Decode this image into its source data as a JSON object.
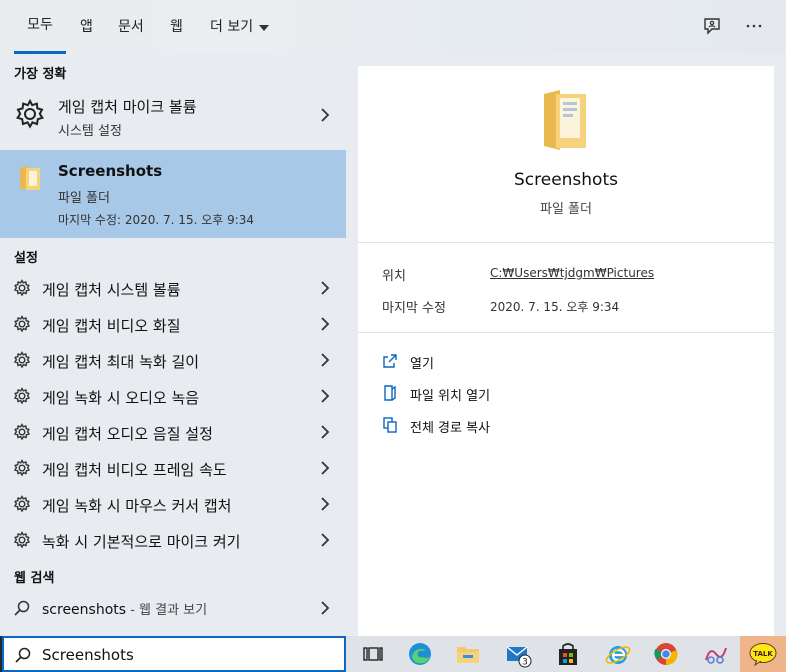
{
  "tabs": [
    {
      "label": "모두",
      "active": true
    },
    {
      "label": "앱"
    },
    {
      "label": "문서"
    },
    {
      "label": "웹"
    },
    {
      "label": "더 보기"
    }
  ],
  "best_match": {
    "heading": "가장 정확",
    "items": [
      {
        "title": "게임 캡처 마이크 볼륨",
        "subtitle": "시스템 설정",
        "icon": "gear-icon"
      },
      {
        "title": "Screenshots",
        "subtitle": "파일 폴더",
        "detail": "마지막 수정: 2020. 7. 15. 오후 9:34",
        "icon": "folder-icon"
      }
    ]
  },
  "settings": {
    "heading": "설정",
    "items": [
      {
        "label": "게임 캡처 시스템 볼륨"
      },
      {
        "label": "게임 캡처 비디오 화질"
      },
      {
        "label": "게임 캡처 최대 녹화 길이"
      },
      {
        "label": "게임 녹화 시 오디오 녹음"
      },
      {
        "label": "게임 캡처 오디오 음질 설정"
      },
      {
        "label": "게임 캡처 비디오 프레임 속도"
      },
      {
        "label": "게임 녹화 시 마우스 커서 캡처"
      },
      {
        "label": "녹화 시 기본적으로 마이크 켜기"
      }
    ]
  },
  "web": {
    "heading": "웹 검색",
    "query": "screenshots",
    "suffix": " - 웹 결과 보기"
  },
  "preview": {
    "title": "Screenshots",
    "subtitle": "파일 폴더",
    "location_label": "위치",
    "location_value": "C:₩Users₩tjdgm₩Pictures",
    "modified_label": "마지막 수정",
    "modified_value": "2020. 7. 15. 오후 9:34",
    "actions": [
      {
        "label": "열기",
        "icon": "open-icon"
      },
      {
        "label": "파일 위치 열기",
        "icon": "file-location-icon"
      },
      {
        "label": "전체 경로 복사",
        "icon": "copy-icon"
      }
    ]
  },
  "search": {
    "value": "Screenshots"
  },
  "taskbar": {
    "mail_badge": "3",
    "kakao_label": "TALK"
  },
  "colors": {
    "accent": "#0a67c2",
    "selected": "#a8c8e8",
    "folder": "#f2c86b"
  }
}
